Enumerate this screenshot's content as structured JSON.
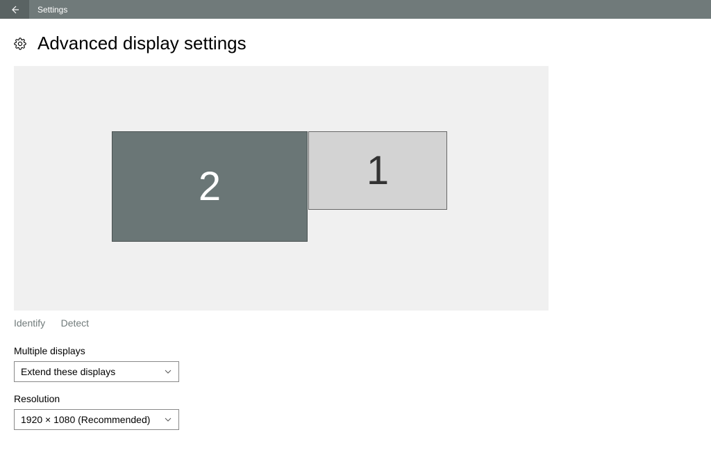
{
  "titlebar": {
    "title": "Settings"
  },
  "page": {
    "title": "Advanced display settings"
  },
  "monitors": {
    "monitor2_label": "2",
    "monitor1_label": "1"
  },
  "links": {
    "identify": "Identify",
    "detect": "Detect"
  },
  "multiple_displays": {
    "label": "Multiple displays",
    "selected": "Extend these displays"
  },
  "resolution": {
    "label": "Resolution",
    "selected": "1920 × 1080 (Recommended)"
  }
}
